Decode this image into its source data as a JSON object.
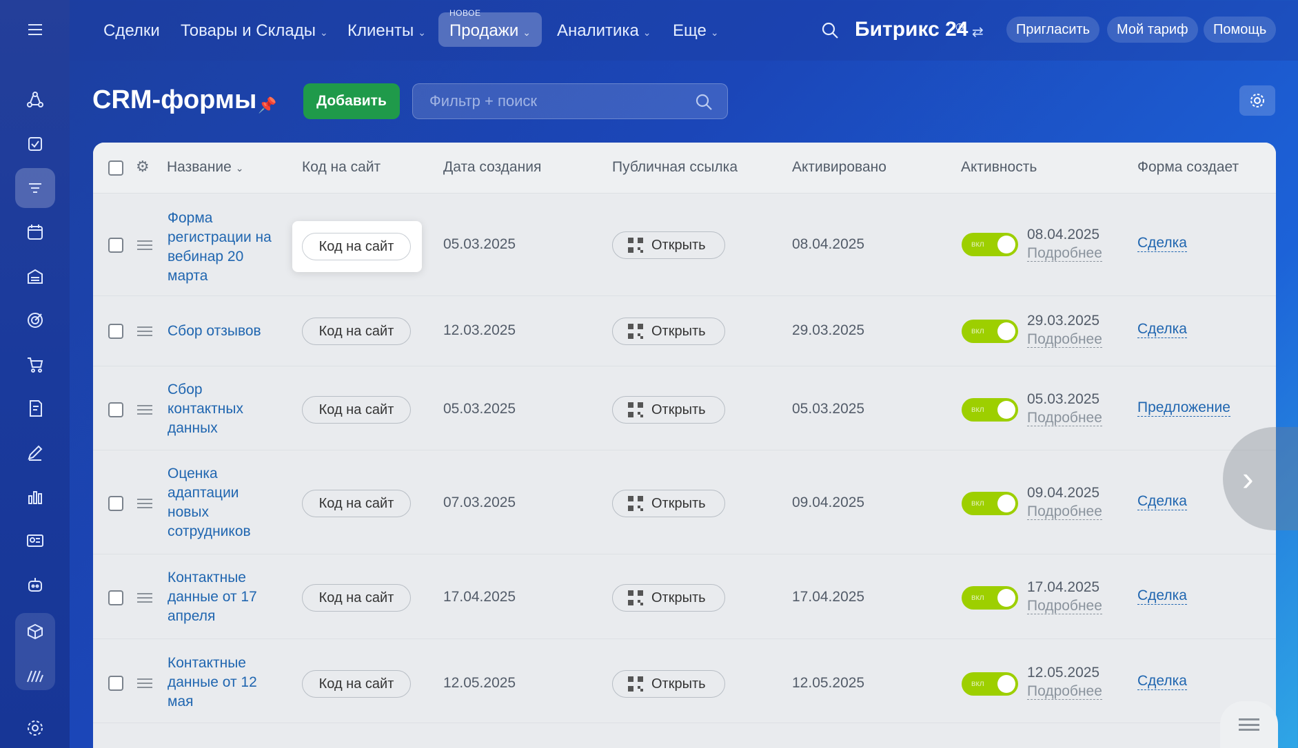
{
  "topbar": {
    "nav": [
      {
        "label": "Сделки",
        "has_menu": false
      },
      {
        "label": "Товары и Склады",
        "has_menu": true
      },
      {
        "label": "Клиенты",
        "has_menu": true
      },
      {
        "label": "Продажи",
        "has_menu": true,
        "active": true,
        "badge": "НОВОЕ"
      },
      {
        "label": "Аналитика",
        "has_menu": true
      },
      {
        "label": "Еще",
        "has_menu": true
      }
    ],
    "brand": "Битрикс",
    "brand_num": "24",
    "invite": "Пригласить",
    "tariff": "Мой тариф",
    "help": "Помощь"
  },
  "page": {
    "title": "CRM-формы",
    "add_button": "Добавить",
    "filter_placeholder": "Фильтр + поиск"
  },
  "table": {
    "columns": [
      "Название",
      "Код на сайт",
      "Дата создания",
      "Публичная ссылка",
      "Активировано",
      "Активность",
      "Форма создает"
    ],
    "code_label": "Код на сайт",
    "open_label": "Открыть",
    "toggle_label": "вкл",
    "more_label": "Подробнее",
    "rows": [
      {
        "name": "Форма регистрации на вебинар 20 марта",
        "created": "05.03.2025",
        "activated": "08.04.2025",
        "activity_date": "08.04.2025",
        "creates": "Сделка"
      },
      {
        "name": "Сбор отзывов",
        "created": "12.03.2025",
        "activated": "29.03.2025",
        "activity_date": "29.03.2025",
        "creates": "Сделка"
      },
      {
        "name": "Сбор контактных данных",
        "created": "05.03.2025",
        "activated": "05.03.2025",
        "activity_date": "05.03.2025",
        "creates": "Предложение"
      },
      {
        "name": "Оценка адаптации новых сотрудников",
        "created": "07.03.2025",
        "activated": "09.04.2025",
        "activity_date": "09.04.2025",
        "creates": "Сделка"
      },
      {
        "name": "Контактные данные от 17 апреля",
        "created": "17.04.2025",
        "activated": "17.04.2025",
        "activity_date": "17.04.2025",
        "creates": "Сделка"
      },
      {
        "name": "Контактные данные от 12 мая",
        "created": "12.05.2025",
        "activated": "12.05.2025",
        "activity_date": "12.05.2025",
        "creates": "Сделка"
      }
    ]
  },
  "colors": {
    "accent_green": "#1f9a4a",
    "toggle_on": "#9dcf00",
    "link_blue": "#2066b0"
  }
}
